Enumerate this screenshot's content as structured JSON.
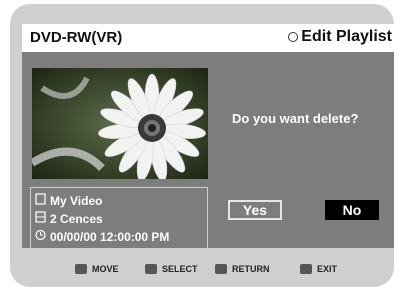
{
  "header": {
    "device": "DVD-RW(VR)",
    "mode": "Edit Playlist"
  },
  "thumbnail": {
    "icon": "flower-thumbnail-image"
  },
  "info": {
    "title": "My Video",
    "scenes": "2 Cences",
    "datetime": "00/00/00 12:00:00  PM"
  },
  "dialog": {
    "question": "Do you want delete?",
    "yes_label": "Yes",
    "no_label": "No"
  },
  "footer": {
    "move": "MOVE",
    "select": "SELECT",
    "return": "RETURN",
    "exit": "EXIT"
  },
  "colors": {
    "screen_bg": "#7d7d7d",
    "frame": "#cfcfcf",
    "header_bg": "#ffffff",
    "no_button_bg": "#000000"
  }
}
